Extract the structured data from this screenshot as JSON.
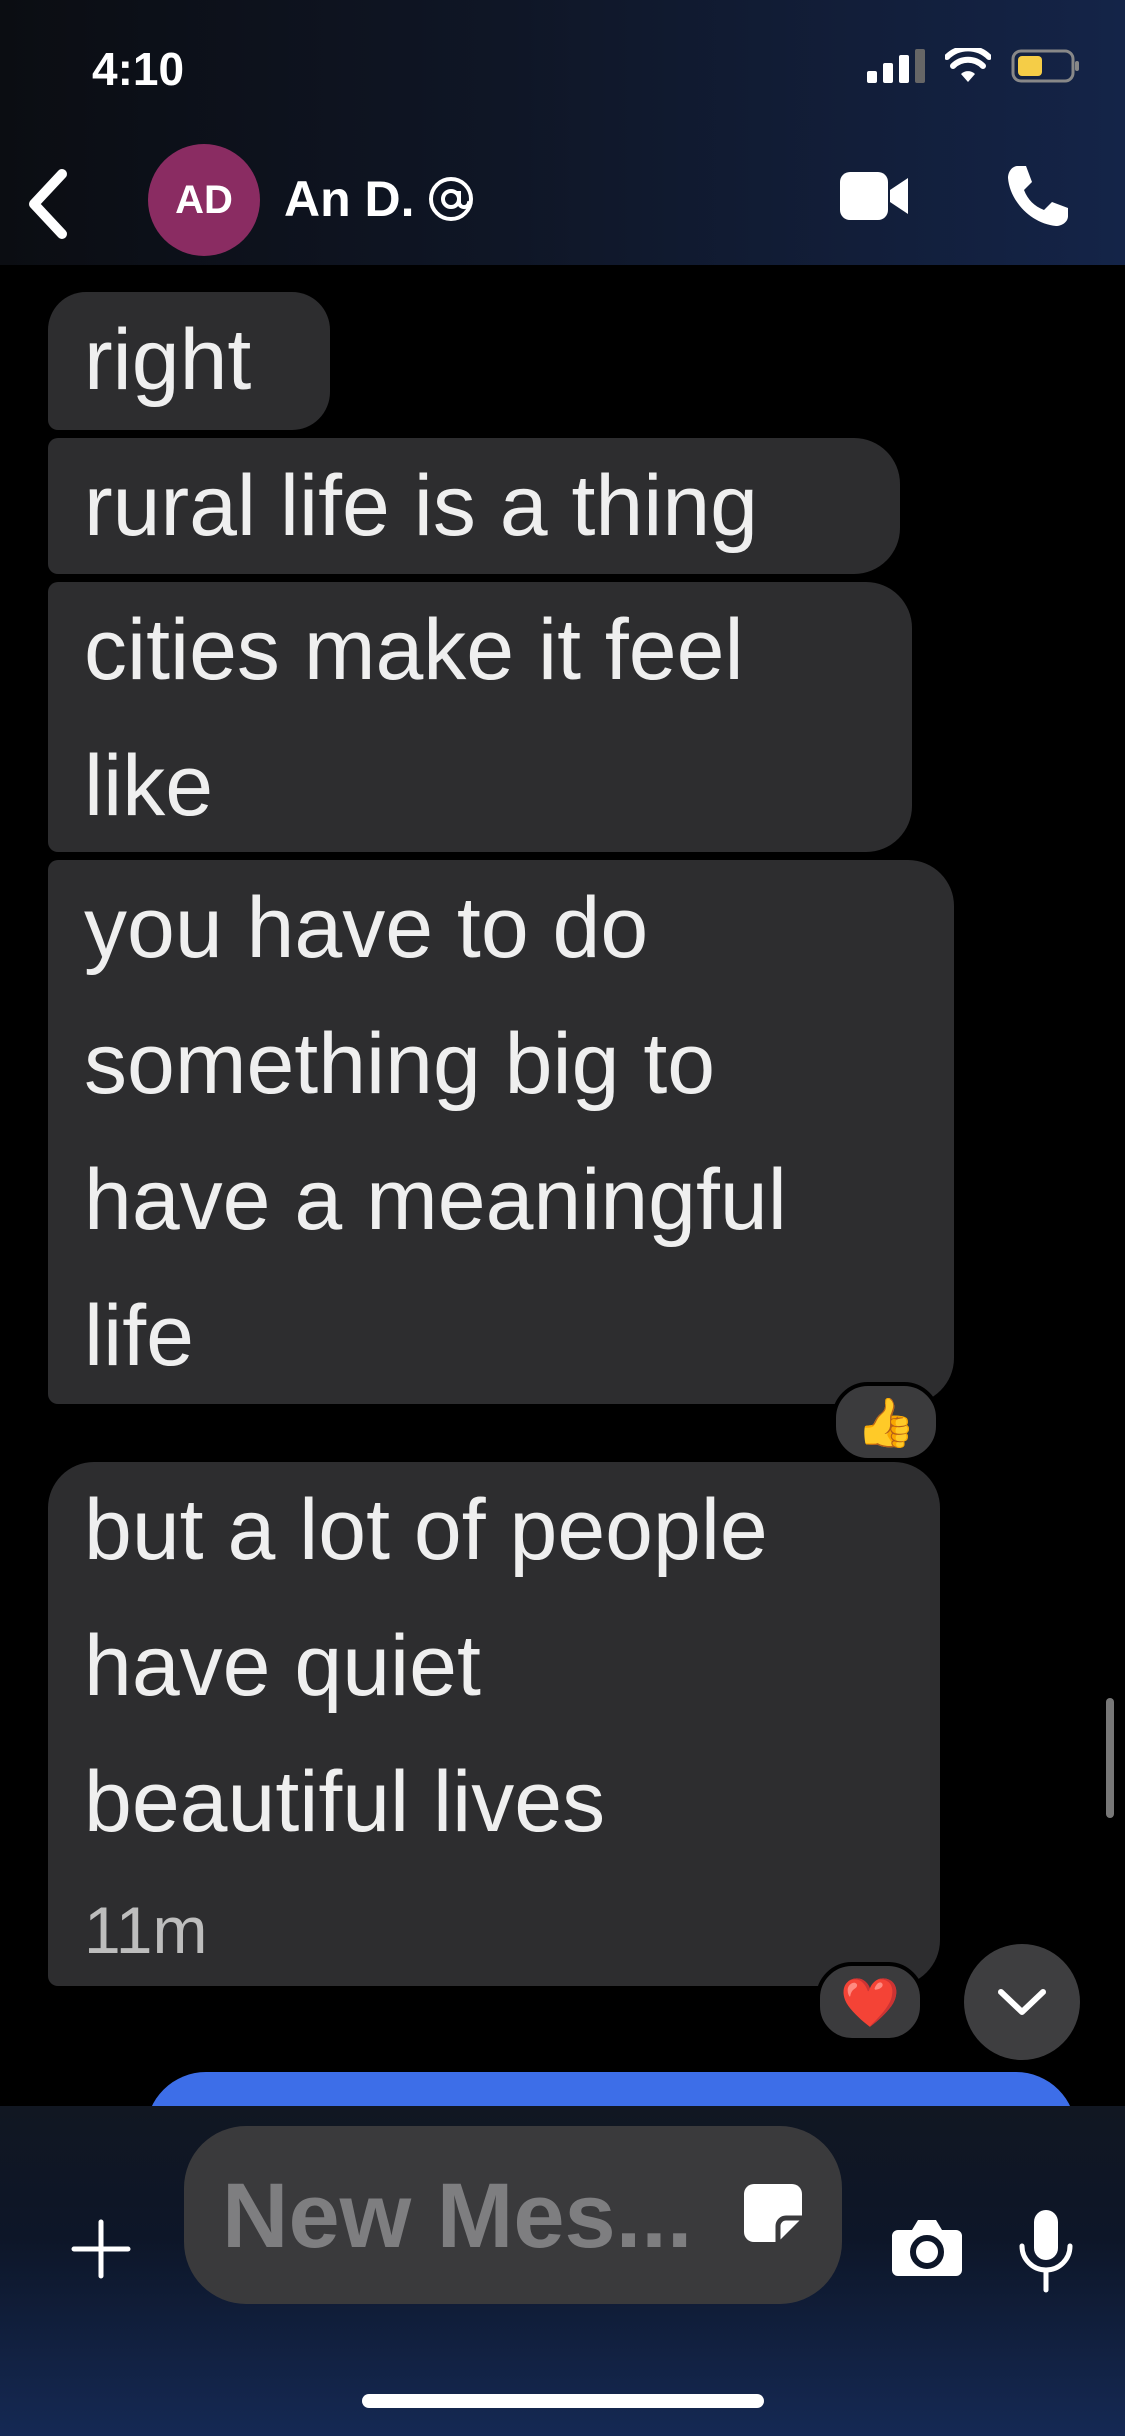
{
  "status_bar": {
    "time": "4:10"
  },
  "header": {
    "avatar_initials": "AD",
    "contact_name": "An D."
  },
  "messages": [
    {
      "lines": [
        "right"
      ]
    },
    {
      "lines": [
        "rural life is a thing"
      ]
    },
    {
      "lines": [
        "cities make it feel",
        "like"
      ]
    },
    {
      "lines": [
        "you have to do",
        "something big to",
        "have a meaningful",
        "life"
      ],
      "reaction": "👍"
    },
    {
      "lines": [
        "but a lot of people",
        "have quiet",
        "beautiful lives"
      ],
      "timestamp": "11m",
      "reaction": "❤️"
    }
  ],
  "composer": {
    "placeholder": "New Mes..."
  },
  "colors": {
    "bubble": "#2d2d2f",
    "accent_blue": "#3d6ee8",
    "avatar": "#8a2c62"
  }
}
